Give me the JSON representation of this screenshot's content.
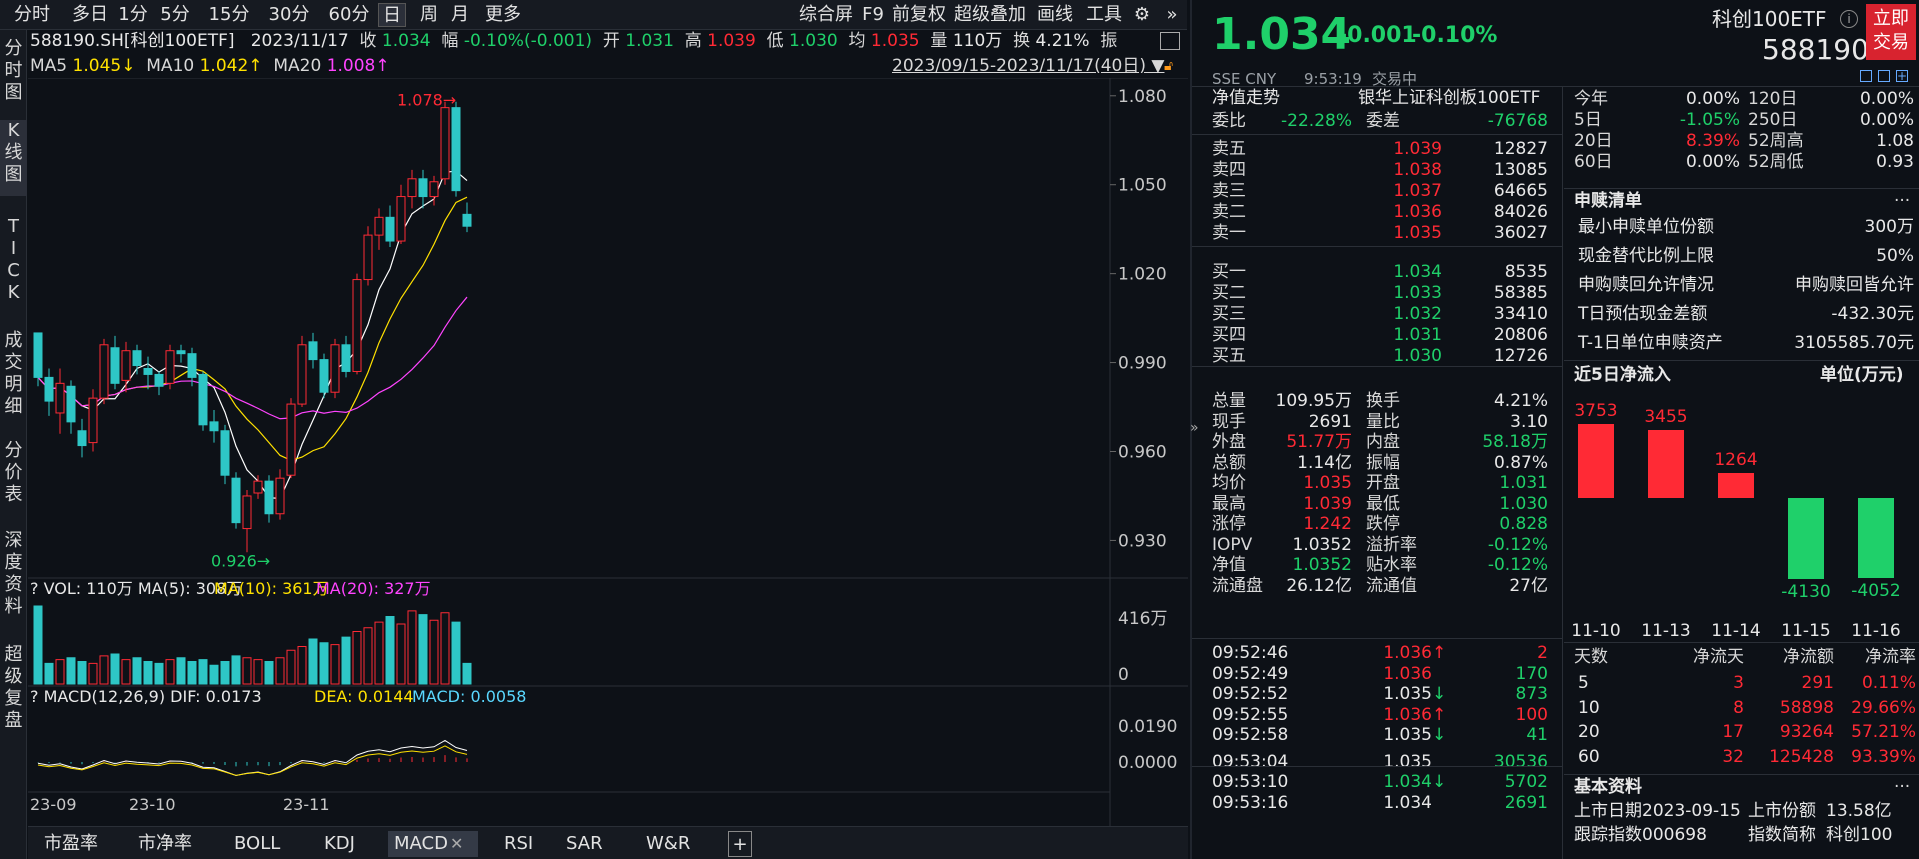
{
  "colors": {
    "up": "#ff2a35",
    "down": "#1fd06a",
    "candle_up": "#ff2a35",
    "candle_down": "#2ec6c6",
    "ma5": "#ffffff",
    "ma10": "#ffe100",
    "ma20": "#ff44ff"
  },
  "periods": [
    "分时",
    "多日",
    "1分",
    "5分",
    "15分",
    "30分",
    "60分",
    "日",
    "周",
    "月",
    "更多"
  ],
  "period_active": "日",
  "toolbar": [
    "综合屏",
    "F9",
    "前复权",
    "超级叠加",
    "画线",
    "工具"
  ],
  "leftnav": [
    "分\n时\n图",
    "K\n线\n图",
    "T\nI\nC\nK",
    "成\n交\n明\n细",
    "分\n价\n表",
    "深\n度\n资\n料",
    "超\n级\n复\n盘"
  ],
  "quote": {
    "symbol": "588190.SH[科创100ETF]",
    "date": "2023/11/17",
    "close_l": "收",
    "close": "1.034",
    "amp_l": "幅",
    "amp": "-0.10%(-0.001)",
    "open_l": "开",
    "open": "1.031",
    "high_l": "高",
    "high": "1.039",
    "low_l": "低",
    "low": "1.030",
    "avg_l": "均",
    "avg": "1.035",
    "vol_l": "量",
    "vol": "110万",
    "turn_l": "换",
    "turn": "4.21%",
    "zhen": "振"
  },
  "ma": {
    "ma5_l": "MA5",
    "ma5": "1.045↓",
    "ma10_l": "MA10",
    "ma10": "1.042↑",
    "ma20_l": "MA20",
    "ma20": "1.008↑"
  },
  "range": "2023/09/15-2023/11/17(40日)",
  "chart_data": {
    "type": "candlestick",
    "ylim": [
      0.918,
      1.086
    ],
    "yticks": [
      "1.080",
      "1.050",
      "1.020",
      "0.990",
      "0.960",
      "0.930"
    ],
    "xticks": [
      "23-09",
      "23-10",
      "23-11"
    ],
    "max_label": "1.078",
    "min_label": "0.926",
    "candles": [
      [
        1.0,
        0.985,
        1.0,
        0.982
      ],
      [
        0.985,
        0.977,
        0.988,
        0.972
      ],
      [
        0.973,
        0.983,
        0.988,
        0.966
      ],
      [
        0.982,
        0.97,
        0.984,
        0.966
      ],
      [
        0.967,
        0.962,
        0.971,
        0.958
      ],
      [
        0.963,
        0.978,
        0.981,
        0.96
      ],
      [
        0.978,
        0.996,
        0.998,
        0.976
      ],
      [
        0.995,
        0.983,
        0.999,
        0.981
      ],
      [
        0.984,
        0.994,
        0.997,
        0.98
      ],
      [
        0.994,
        0.989,
        0.996,
        0.986
      ],
      [
        0.988,
        0.986,
        0.992,
        0.981
      ],
      [
        0.986,
        0.982,
        0.987,
        0.979
      ],
      [
        0.983,
        0.994,
        0.996,
        0.981
      ],
      [
        0.994,
        0.993,
        0.996,
        0.99
      ],
      [
        0.993,
        0.985,
        0.995,
        0.982
      ],
      [
        0.986,
        0.969,
        0.987,
        0.967
      ],
      [
        0.97,
        0.967,
        0.974,
        0.963
      ],
      [
        0.967,
        0.952,
        0.969,
        0.949
      ],
      [
        0.951,
        0.936,
        0.953,
        0.934
      ],
      [
        0.934,
        0.945,
        0.947,
        0.926
      ],
      [
        0.946,
        0.95,
        0.952,
        0.944
      ],
      [
        0.95,
        0.939,
        0.952,
        0.936
      ],
      [
        0.939,
        0.951,
        0.954,
        0.937
      ],
      [
        0.952,
        0.976,
        0.978,
        0.951
      ],
      [
        0.976,
        0.996,
        0.999,
        0.975
      ],
      [
        0.997,
        0.991,
        1.0,
        0.988
      ],
      [
        0.991,
        0.98,
        0.993,
        0.978
      ],
      [
        0.98,
        0.996,
        0.998,
        0.978
      ],
      [
        0.996,
        0.987,
        0.999,
        0.985
      ],
      [
        0.987,
        1.018,
        1.02,
        0.986
      ],
      [
        1.018,
        1.033,
        1.036,
        1.016
      ],
      [
        1.033,
        1.039,
        1.042,
        1.028
      ],
      [
        1.039,
        1.031,
        1.043,
        1.029
      ],
      [
        1.031,
        1.046,
        1.05,
        1.03
      ],
      [
        1.046,
        1.052,
        1.055,
        1.042
      ],
      [
        1.052,
        1.046,
        1.055,
        1.042
      ],
      [
        1.046,
        1.051,
        1.053,
        1.043
      ],
      [
        1.052,
        1.076,
        1.078,
        1.05
      ],
      [
        1.076,
        1.048,
        1.078,
        1.046
      ],
      [
        1.04,
        1.036,
        1.044,
        1.034
      ]
    ],
    "volume": {
      "label": "VOL: 110万",
      "ma5_l": "MA(5): 308万",
      "ma10_l": "MA(10): 361万",
      "ma20_l": "MA(20): 327万",
      "ytop": "416万",
      "ybot": "0",
      "values": [
        4.16,
        1.1,
        1.3,
        1.4,
        1.2,
        1.1,
        1.5,
        1.6,
        1.3,
        1.4,
        1.2,
        1.1,
        1.3,
        1.4,
        1.2,
        1.3,
        1.0,
        1.2,
        1.5,
        1.4,
        1.3,
        1.2,
        1.4,
        1.8,
        2.0,
        2.4,
        2.2,
        2.1,
        2.5,
        2.8,
        3.0,
        3.3,
        3.6,
        3.2,
        3.9,
        3.7,
        3.4,
        3.8,
        3.3,
        1.1
      ]
    },
    "macd": {
      "label": "MACD(12,26,9)",
      "dif_l": "DIF: 0.0173",
      "dea_l": "DEA: 0.0144",
      "macd_l": "MACD: 0.0058",
      "ytop": "0.0190",
      "ybot": "0.0000"
    }
  },
  "bottomtabs": [
    "市盈率",
    "市净率",
    "BOLL",
    "KDJ",
    "MACD",
    "RSI",
    "SAR",
    "W&R"
  ],
  "price": {
    "last": "1.034",
    "chg": "-0.001",
    "pct": "-0.10%",
    "name": "科创100ETF",
    "code": "588190",
    "trade": "立即\n交易",
    "market": "SSE  CNY",
    "time": "9:53:19",
    "status": "交易中"
  },
  "nav": {
    "title": "净值走势",
    "index": "银华上证科创板100ETF"
  },
  "weibi": {
    "wb_l": "委比",
    "wb": "-22.28%",
    "wc_l": "委差",
    "wc": "-76768"
  },
  "asks": [
    {
      "l": "卖五",
      "p": "1.039",
      "v": "12827"
    },
    {
      "l": "卖四",
      "p": "1.038",
      "v": "13085"
    },
    {
      "l": "卖三",
      "p": "1.037",
      "v": "64665"
    },
    {
      "l": "卖二",
      "p": "1.036",
      "v": "84026"
    },
    {
      "l": "卖一",
      "p": "1.035",
      "v": "36027"
    }
  ],
  "bids": [
    {
      "l": "买一",
      "p": "1.034",
      "v": "8535"
    },
    {
      "l": "买二",
      "p": "1.033",
      "v": "58385"
    },
    {
      "l": "买三",
      "p": "1.032",
      "v": "33410"
    },
    {
      "l": "买四",
      "p": "1.031",
      "v": "20806"
    },
    {
      "l": "买五",
      "p": "1.030",
      "v": "12726"
    }
  ],
  "stats": [
    [
      "总量",
      "109.95万",
      "换手",
      "4.21%"
    ],
    [
      "现手",
      "2691",
      "量比",
      "3.10"
    ],
    [
      "外盘",
      "51.77万",
      "内盘",
      "58.18万"
    ],
    [
      "总额",
      "1.14亿",
      "振幅",
      "0.87%"
    ],
    [
      "均价",
      "1.035",
      "开盘",
      "1.031"
    ],
    [
      "最高",
      "1.039",
      "最低",
      "1.030"
    ],
    [
      "涨停",
      "1.242",
      "跌停",
      "0.828"
    ],
    [
      "IOPV",
      "1.0352",
      "溢折率",
      "-0.12%"
    ],
    [
      "净值",
      "1.0352",
      "贴水率",
      "-0.12%"
    ],
    [
      "流通盘",
      "26.12亿",
      "流通值",
      "27亿"
    ]
  ],
  "ticks": [
    {
      "t": "09:52:46",
      "p": "1.036",
      "a": "↑",
      "v": "2"
    },
    {
      "t": "09:52:49",
      "p": "1.036",
      "a": "",
      "v": "170"
    },
    {
      "t": "09:52:52",
      "p": "1.035",
      "a": "↓",
      "v": "873"
    },
    {
      "t": "09:52:55",
      "p": "1.036",
      "a": "↑",
      "v": "100"
    },
    {
      "t": "09:52:58",
      "p": "1.035",
      "a": "↓",
      "v": "41"
    },
    {
      "t": "09:53:04",
      "p": "1.035",
      "a": "",
      "v": "30536"
    },
    {
      "t": "09:53:10",
      "p": "1.034",
      "a": "↓",
      "v": "5702"
    },
    {
      "t": "09:53:16",
      "p": "1.034",
      "a": "",
      "v": "2691"
    }
  ],
  "returns": [
    [
      "今年",
      "0.00%",
      "120日",
      "0.00%"
    ],
    [
      "5日",
      "-1.05%",
      "250日",
      "0.00%"
    ],
    [
      "20日",
      "8.39%",
      "52周高",
      "1.08"
    ],
    [
      "60日",
      "0.00%",
      "52周低",
      "0.93"
    ]
  ],
  "sg": {
    "title": "申赎清单",
    "more": "···",
    "rows": [
      [
        "最小申赎单位份额",
        "300万"
      ],
      [
        "现金替代比例上限",
        "50%"
      ],
      [
        "申购赎回允许情况",
        "申购赎回皆允许"
      ],
      [
        "T日预估现金差额",
        "-432.30元"
      ],
      [
        "T-1日单位申赎资产",
        "3105585.70元"
      ]
    ]
  },
  "flow": {
    "title": "近5日净流入",
    "unit": "单位(万元)",
    "bars": [
      {
        "d": "11-10",
        "v": 3753
      },
      {
        "d": "11-13",
        "v": 3455
      },
      {
        "d": "11-14",
        "v": 1264
      },
      {
        "d": "11-15",
        "v": -4130
      },
      {
        "d": "11-16",
        "v": -4052
      }
    ]
  },
  "flowtbl": {
    "head": [
      "天数",
      "净流天",
      "净流额",
      "净流率"
    ],
    "rows": [
      [
        "5",
        "3",
        "291",
        "0.11%"
      ],
      [
        "10",
        "8",
        "58898",
        "29.66%"
      ],
      [
        "20",
        "17",
        "93264",
        "57.21%"
      ],
      [
        "60",
        "32",
        "125428",
        "93.39%"
      ]
    ]
  },
  "basic": {
    "title": "基本资料",
    "more": "···",
    "row1": [
      "上市日期",
      "2023-09-15",
      "上市份额",
      "13.58亿"
    ],
    "row2": [
      "跟踪指数",
      "000698",
      "指数简称",
      "科创100"
    ]
  }
}
